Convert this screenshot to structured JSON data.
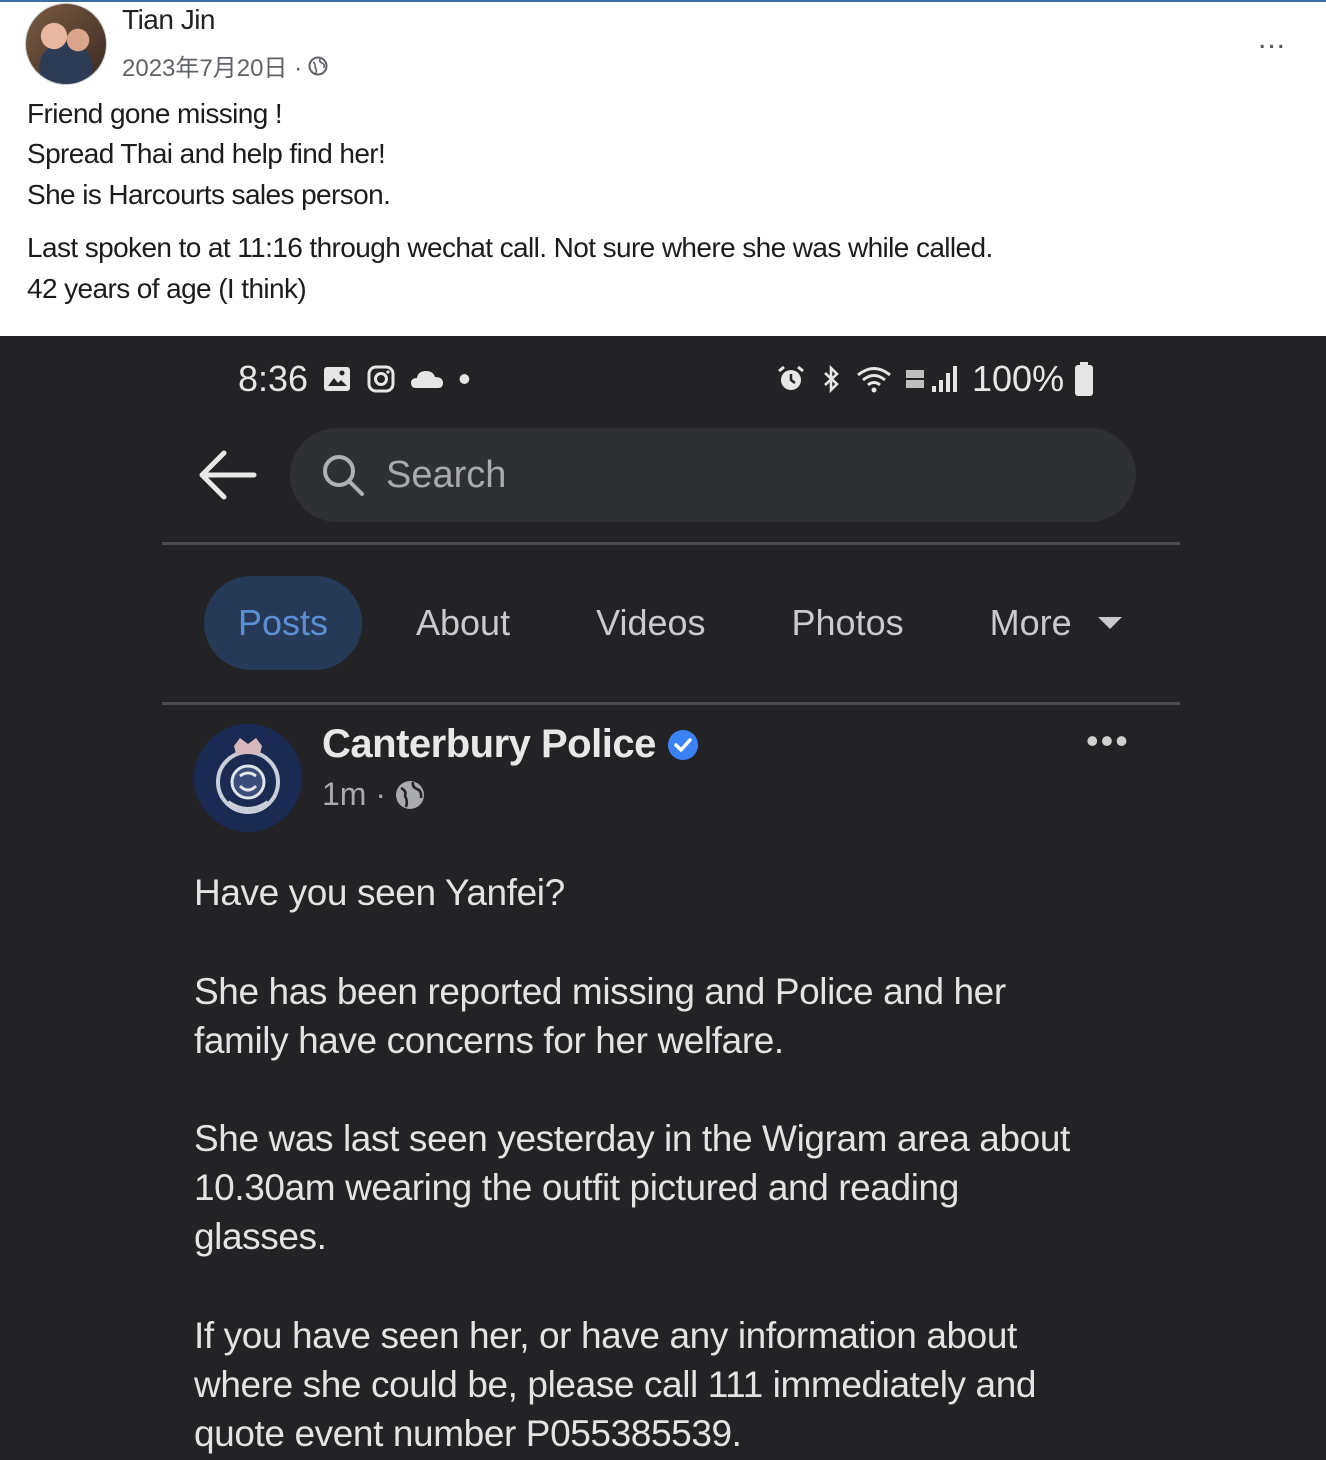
{
  "outer_post": {
    "author": "Tian Jin",
    "date": "2023年7月20日 ·",
    "more_dots": "...",
    "lines": [
      "Friend gone missing !",
      "Spread Thai and help find her!",
      "She is Harcourts sales person.",
      "Last spoken to at 11:16 through wechat call. Not sure where she was while called.",
      "42 years of age (I think)"
    ]
  },
  "phone": {
    "status": {
      "time": "8:36",
      "dot": "•",
      "battery": "100%"
    },
    "search": {
      "placeholder": "Search"
    },
    "tabs": [
      {
        "label": "Posts",
        "active": true
      },
      {
        "label": "About"
      },
      {
        "label": "Videos"
      },
      {
        "label": "Photos"
      },
      {
        "label": "More"
      }
    ],
    "post": {
      "page_name": "Canterbury Police",
      "time": "1m ·",
      "more_dots": "•••",
      "paragraphs": [
        "Have you seen Yanfei?",
        "She has been reported missing and Police and her",
        "family have concerns for her welfare.",
        "She was last seen yesterday in the Wigram area about",
        "10.30am wearing the outfit pictured and reading",
        "glasses.",
        "If you have seen her, or have any information about",
        "where she could be, please call 111 immediately and",
        "quote event number P055385539."
      ]
    }
  },
  "colors": {
    "dark_bg": "#232326",
    "active_tab_bg": "#263a57",
    "active_tab_text": "#5a8fd6",
    "verified_blue": "#3b82f6"
  }
}
